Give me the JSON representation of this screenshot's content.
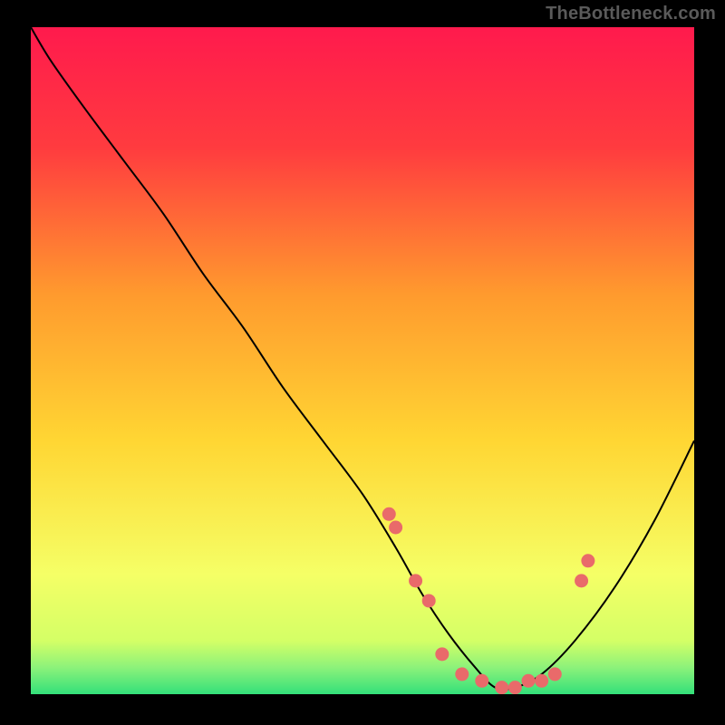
{
  "watermark": "TheBottleneck.com",
  "chart_data": {
    "type": "line",
    "title": "",
    "xlabel": "",
    "ylabel": "",
    "xlim": [
      0,
      100
    ],
    "ylim": [
      0,
      100
    ],
    "background_gradient": {
      "top": "#ff1a4d",
      "mid": "#ffd633",
      "near_bottom": "#f5ff66",
      "bottom_band": "#33e07a"
    },
    "series": [
      {
        "name": "bottleneck-curve",
        "x": [
          0,
          3,
          8,
          14,
          20,
          26,
          32,
          38,
          44,
          50,
          55,
          59,
          63,
          67,
          70,
          73,
          77,
          82,
          88,
          94,
          100
        ],
        "y": [
          100,
          95,
          88,
          80,
          72,
          63,
          55,
          46,
          38,
          30,
          22,
          15,
          9,
          4,
          1,
          1,
          3,
          8,
          16,
          26,
          38
        ]
      }
    ],
    "scatter_points": {
      "name": "highlight-points",
      "color": "#e96a6a",
      "x": [
        54,
        55,
        58,
        60,
        62,
        65,
        68,
        71,
        73,
        75,
        77,
        79,
        83,
        84
      ],
      "y": [
        27,
        25,
        17,
        14,
        6,
        3,
        2,
        1,
        1,
        2,
        2,
        3,
        17,
        20
      ]
    }
  }
}
